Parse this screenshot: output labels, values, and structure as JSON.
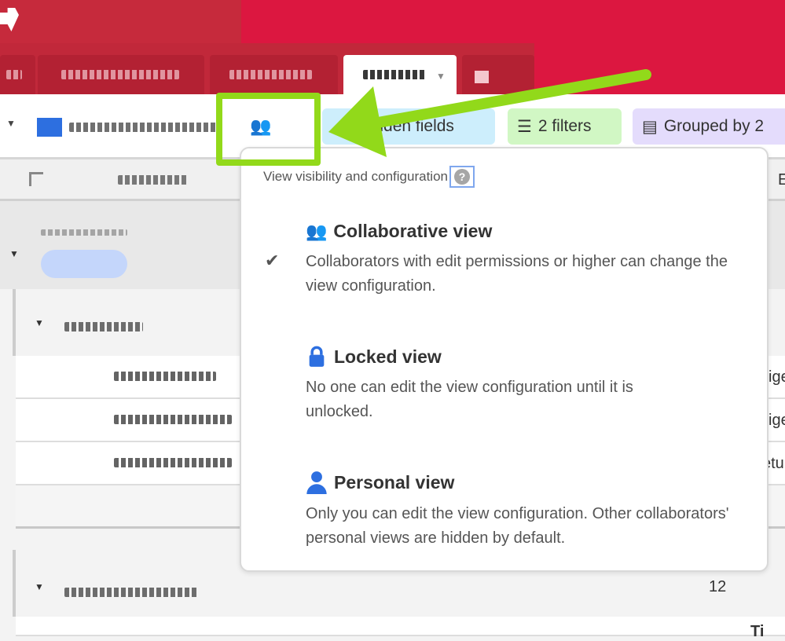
{
  "toolbar": {
    "hidden_fields": "hidden fields",
    "filters": "2 filters",
    "grouped": "Grouped by 2",
    "view_type_icon": "people-icon"
  },
  "popover": {
    "title": "View visibility and configuration",
    "help": "?",
    "options": [
      {
        "title": "Collaborative view",
        "desc": "Collaborators with edit permissions or higher can change the view configuration.",
        "icon": "people-icon",
        "selected": true
      },
      {
        "title": "Locked view",
        "desc": "No one can edit the view configuration until it is unlocked.",
        "icon": "lock-icon",
        "selected": false
      },
      {
        "title": "Personal view",
        "desc": "Only you can edit the view configuration. Other collaborators' personal views are hidden by default.",
        "icon": "person-icon",
        "selected": false
      }
    ]
  },
  "grid": {
    "col_partial": "E",
    "cells": [
      "ige",
      "ige",
      "etu"
    ],
    "count": "12",
    "bottom_partial": "Ti"
  },
  "colors": {
    "header": "#dc1740",
    "highlight": "#92d91a",
    "accent": "#2d6fe0"
  }
}
